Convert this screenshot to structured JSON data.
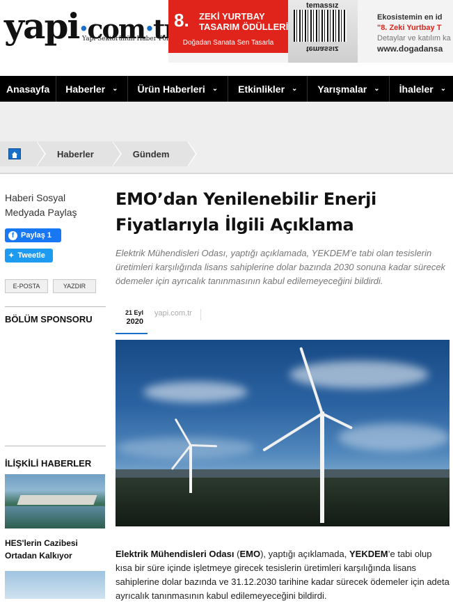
{
  "header": {
    "logo_word": "yapi",
    "logo_dot": "·",
    "logo_com": "com",
    "logo_tr": "tr",
    "logo_tagline": "Yapı Sektörünün Haber Portalı",
    "banner": {
      "number": "8.",
      "line1": "ZEKİ YURTBAY",
      "line2": "TASARIM ÖDÜLLERİ",
      "slogan": "Doğadan Sanata Sen Tasarla",
      "art_word": "temassız",
      "right_line1": "Ekosistemin en id",
      "right_line2": "\"8. Zeki Yurtbay T",
      "right_line3": "Detaylar ve katılım ka",
      "right_line4": "www.dogadansa"
    }
  },
  "nav": {
    "items": [
      {
        "label": "Anasayfa",
        "has_dropdown": false
      },
      {
        "label": "Haberler",
        "has_dropdown": true
      },
      {
        "label": "Ürün Haberleri",
        "has_dropdown": true
      },
      {
        "label": "Etkinlikler",
        "has_dropdown": true
      },
      {
        "label": "Yarışmalar",
        "has_dropdown": true
      },
      {
        "label": "İhaleler",
        "has_dropdown": true
      }
    ]
  },
  "breadcrumb": {
    "items": [
      "Haberler",
      "Gündem"
    ]
  },
  "sidebar": {
    "share_title": "Haberi Sosyal Medyada Paylaş",
    "facebook_label": "Paylaş 1",
    "twitter_label": "Tweetle",
    "email_label": "E-POSTA",
    "print_label": "YAZDIR",
    "sponsor_heading": "BÖLÜM SPONSORU",
    "related_heading": "İLİŞKİLİ HABERLER",
    "related_title": "HES'lerin Cazibesi Ortadan Kalkıyor"
  },
  "article": {
    "title": "EMO’dan Yenilenebilir Enerji Fiyatlarıyla İlgili Açıklama",
    "lead": "Elektrik Mühendisleri Odası, yaptığı açıklamada, YEKDEM’e tabi olan tesislerin üretimleri karşılığında lisans sahiplerine dolar bazında 2030 sonuna kadar sürecek ödemeler için ayrıcalık tanınmasının kabul edilemeyeceğini bildirdi.",
    "date_day": "21 Eyl",
    "date_year": "2020",
    "source": "yapi.com.tr",
    "body_bold1": "Elektrik Mühendisleri Odası",
    "body_t1": " (",
    "body_bold2": "EMO",
    "body_t2": "), yaptığı açıklamada, ",
    "body_bold3": "YEKDEM",
    "body_t3": "’e tabi olup kısa bir süre içinde işletmeye girecek tesislerin üretimleri karşılığında lisans sahiplerine dolar bazında ve 31.12.2030 tarihine kadar sürecek ödemeler için adeta ayrıcalık tanınmasının kabul edilemeyeceğini bildirdi."
  },
  "colors": {
    "accent": "#1a6fc9",
    "nav_bg": "#000000",
    "banner_red": "#e0241b",
    "facebook": "#1877f2",
    "twitter": "#1d9bf0"
  }
}
